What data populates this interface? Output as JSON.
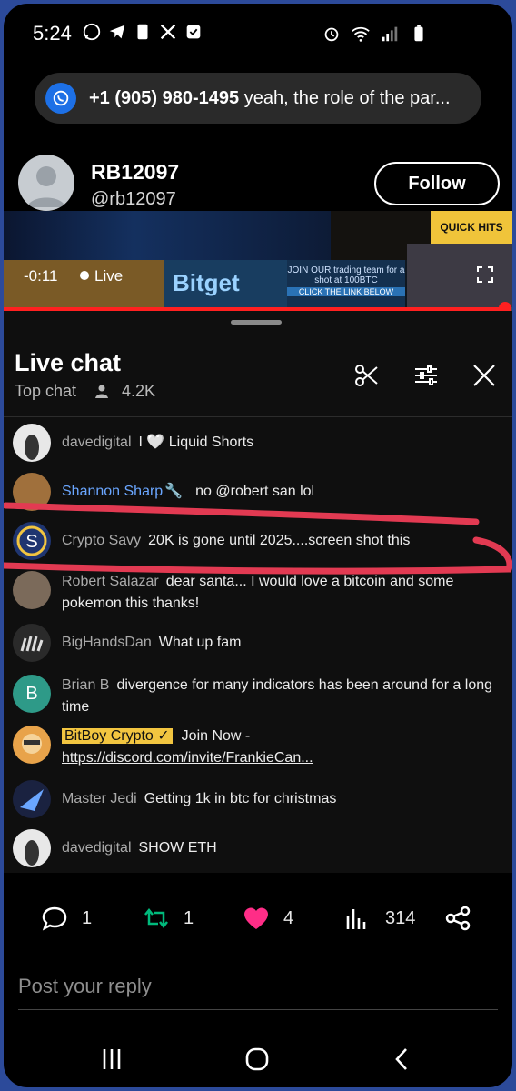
{
  "status_bar": {
    "time": "5:24"
  },
  "notification": {
    "sender": "+1 (905) 980-1495",
    "preview": "yeah, the role of the par..."
  },
  "profile": {
    "display_name": "RB12097",
    "handle": "@rb12097",
    "follow_label": "Follow"
  },
  "video": {
    "elapsed": "-0:11",
    "live_label": "Live",
    "banner_brand": "Bitget",
    "banner_promo": "JOIN OUR trading team for a shot at 100BTC",
    "banner_cta": "CLICK THE LINK BELOW",
    "quick_hits": "QUICK HITS",
    "progress_fraction": 0.98
  },
  "live_chat": {
    "title": "Live chat",
    "filter_label": "Top chat",
    "viewer_count": "4.2K",
    "messages": [
      {
        "author": "davedigital",
        "text": "I 🤍 Liquid Shorts"
      },
      {
        "author": "Shannon Sharp",
        "badge": "🔧",
        "text": "no @robert san lol"
      },
      {
        "author": "Crypto Savy",
        "text": "20K is gone until 2025....screen shot this"
      },
      {
        "author": "Robert Salazar",
        "text": "dear santa... I would love a bitcoin and some pokemon this thanks!"
      },
      {
        "author": "BigHandsDan",
        "text": "What up fam"
      },
      {
        "author": "Brian B",
        "avatar_letter": "B",
        "text": "divergence for many indicators has been around for a long time"
      },
      {
        "author": "BitBoy Crypto",
        "badge": "✓",
        "text": "Join Now - ",
        "link": "https://discord.com/invite/FrankieCan..."
      },
      {
        "author": "Master Jedi",
        "text": "Getting 1k in btc for christmas"
      },
      {
        "author": "davedigital",
        "text": "SHOW ETH"
      }
    ]
  },
  "tweet_actions": {
    "replies": "1",
    "retweets": "1",
    "likes": "4",
    "views": "314"
  },
  "reply_box": {
    "placeholder": "Post your reply"
  },
  "colors": {
    "like": "#ff2d87",
    "retweet": "#00ba7c",
    "live_red": "#ff2020",
    "highlight": "#f2c540"
  }
}
